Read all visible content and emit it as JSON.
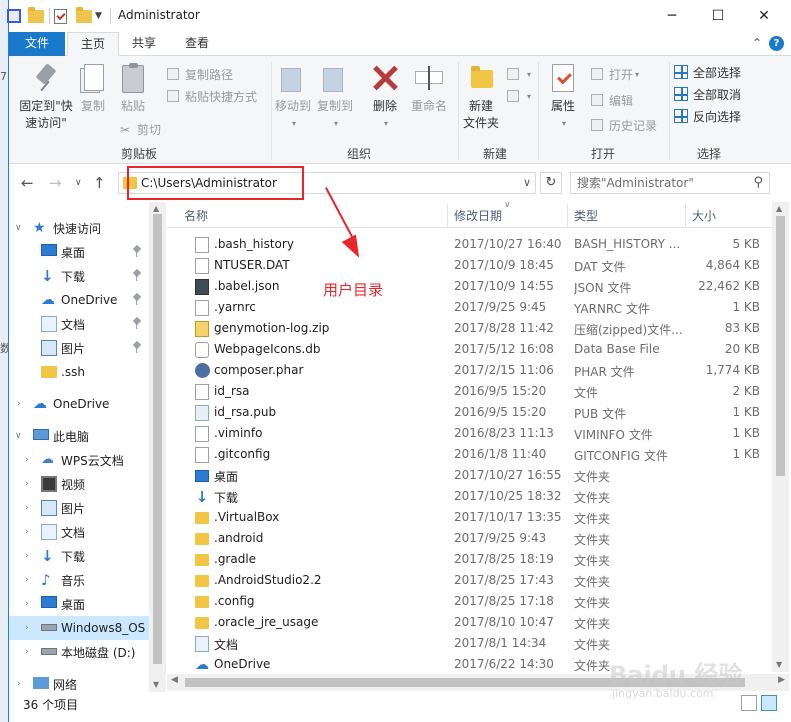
{
  "window": {
    "title": "Administrator",
    "minimize": "─",
    "maximize": "☐",
    "close": "✕"
  },
  "ribbon_tabs": [
    "文件",
    "主页",
    "共享",
    "查看"
  ],
  "ribbon": {
    "clipboard": {
      "pin": "固定到\"快\n速访问\"",
      "copy": "复制",
      "paste": "粘贴",
      "copy_path": "复制路径",
      "paste_shortcut": "粘贴快捷方式",
      "cut": "剪切",
      "label": "剪贴板"
    },
    "organize": {
      "move_to": "移动到",
      "copy_to": "复制到",
      "delete": "删除",
      "rename": "重命名",
      "label": "组织"
    },
    "new": {
      "new_folder": "新建\n文件夹",
      "label": "新建"
    },
    "open": {
      "properties": "属性",
      "open": "打开",
      "edit": "编辑",
      "history": "历史记录",
      "label": "打开"
    },
    "select": {
      "select_all": "全部选择",
      "select_none": "全部取消",
      "invert": "反向选择",
      "label": "选择"
    }
  },
  "address": {
    "path": "C:\\Users\\Administrator",
    "search_placeholder": "搜索\"Administrator\""
  },
  "annotation": {
    "text": "用户目录",
    "color": "#e8262b"
  },
  "nav_pane": [
    {
      "label": "快速访问",
      "icon": "star-icon"
    },
    {
      "label": "桌面",
      "icon": "desktop-icon"
    },
    {
      "label": "下载",
      "icon": "download-icon"
    },
    {
      "label": "OneDrive",
      "icon": "cloud-icon"
    },
    {
      "label": "文档",
      "icon": "documents-icon"
    },
    {
      "label": "图片",
      "icon": "pictures-icon"
    },
    {
      "label": ".ssh",
      "icon": "folder-icon"
    },
    {
      "label": "OneDrive",
      "icon": "cloud-icon"
    },
    {
      "label": "此电脑",
      "icon": "computer-icon"
    },
    {
      "label": "WPS云文档",
      "icon": "wps-cloud-icon"
    },
    {
      "label": "视频",
      "icon": "video-icon"
    },
    {
      "label": "图片",
      "icon": "pictures-icon"
    },
    {
      "label": "文档",
      "icon": "documents-icon"
    },
    {
      "label": "下载",
      "icon": "download-icon"
    },
    {
      "label": "音乐",
      "icon": "music-icon"
    },
    {
      "label": "桌面",
      "icon": "desktop-icon"
    },
    {
      "label": "Windows8_OS",
      "icon": "drive-icon"
    },
    {
      "label": "本地磁盘 (D:)",
      "icon": "drive-icon"
    },
    {
      "label": "网络",
      "icon": "network-icon"
    }
  ],
  "columns": {
    "name": "名称",
    "date": "修改日期",
    "type": "类型",
    "size": "大小"
  },
  "files": [
    {
      "name": ".bash_history",
      "date": "2017/10/27 16:40",
      "type": "BASH_HISTORY ...",
      "size": "5 KB",
      "icon": "file-icon"
    },
    {
      "name": "NTUSER.DAT",
      "date": "2017/10/9 18:45",
      "type": "DAT 文件",
      "size": "4,864 KB",
      "icon": "file-icon"
    },
    {
      "name": ".babel.json",
      "date": "2017/10/9 14:55",
      "type": "JSON 文件",
      "size": "22,462 KB",
      "icon": "json-icon"
    },
    {
      "name": ".yarnrc",
      "date": "2017/9/25 9:45",
      "type": "YARNRC 文件",
      "size": "1 KB",
      "icon": "file-icon"
    },
    {
      "name": "genymotion-log.zip",
      "date": "2017/8/28 11:42",
      "type": "压缩(zipped)文件...",
      "size": "83 KB",
      "icon": "zip-icon"
    },
    {
      "name": "WebpageIcons.db",
      "date": "2017/5/12 16:08",
      "type": "Data Base File",
      "size": "20 KB",
      "icon": "database-icon"
    },
    {
      "name": "composer.phar",
      "date": "2017/2/15 11:06",
      "type": "PHAR 文件",
      "size": "1,774 KB",
      "icon": "phar-icon"
    },
    {
      "name": "id_rsa",
      "date": "2016/9/5 15:20",
      "type": "文件",
      "size": "2 KB",
      "icon": "file-icon"
    },
    {
      "name": "id_rsa.pub",
      "date": "2016/9/5 15:20",
      "type": "PUB 文件",
      "size": "1 KB",
      "icon": "pub-icon"
    },
    {
      "name": ".viminfo",
      "date": "2016/8/23 11:13",
      "type": "VIMINFO 文件",
      "size": "1 KB",
      "icon": "file-icon"
    },
    {
      "name": ".gitconfig",
      "date": "2016/1/8 11:40",
      "type": "GITCONFIG 文件",
      "size": "1 KB",
      "icon": "file-icon"
    },
    {
      "name": "桌面",
      "date": "2017/10/27 16:55",
      "type": "文件夹",
      "size": "",
      "icon": "desktop-icon"
    },
    {
      "name": "下载",
      "date": "2017/10/25 18:32",
      "type": "文件夹",
      "size": "",
      "icon": "download-icon"
    },
    {
      "name": ".VirtualBox",
      "date": "2017/10/17 13:35",
      "type": "文件夹",
      "size": "",
      "icon": "folder-icon"
    },
    {
      "name": ".android",
      "date": "2017/9/25 9:43",
      "type": "文件夹",
      "size": "",
      "icon": "folder-icon"
    },
    {
      "name": ".gradle",
      "date": "2017/8/25 18:19",
      "type": "文件夹",
      "size": "",
      "icon": "folder-icon"
    },
    {
      "name": ".AndroidStudio2.2",
      "date": "2017/8/25 17:43",
      "type": "文件夹",
      "size": "",
      "icon": "folder-icon"
    },
    {
      "name": ".config",
      "date": "2017/8/25 17:18",
      "type": "文件夹",
      "size": "",
      "icon": "folder-icon"
    },
    {
      "name": ".oracle_jre_usage",
      "date": "2017/8/10 10:47",
      "type": "文件夹",
      "size": "",
      "icon": "folder-icon"
    },
    {
      "name": "文档",
      "date": "2017/8/1 14:34",
      "type": "文件夹",
      "size": "",
      "icon": "documents-icon"
    },
    {
      "name": "OneDrive",
      "date": "2017/6/22 14:30",
      "type": "文件夹",
      "size": "",
      "icon": "cloud-icon"
    }
  ],
  "status": {
    "count": "36 个项目"
  },
  "watermark": {
    "main": "Baidu 经验",
    "sub": "jingyan.baidu.com"
  }
}
